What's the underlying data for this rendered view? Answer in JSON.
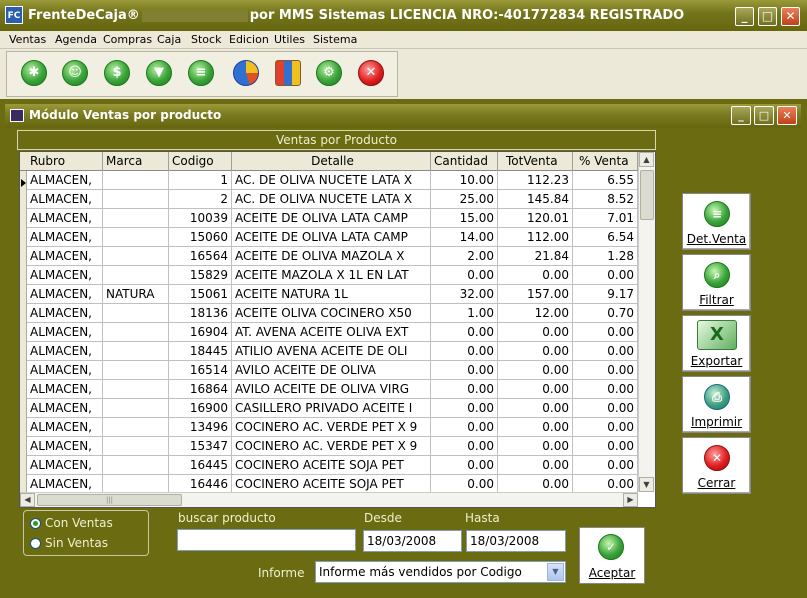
{
  "app": {
    "title_left": "FrenteDeCaja®",
    "title_right": "por MMS Sistemas       LICENCIA NRO:-401772834 REGISTRADO",
    "logo_text": "FC"
  },
  "window_buttons": {
    "minimize": "_",
    "maximize": "□",
    "close": "✕"
  },
  "menu": [
    "Ventas",
    "Agenda",
    "Compras",
    "Caja",
    "Stock",
    "Edicion",
    "Utiles",
    "Sistema"
  ],
  "toolbar": {
    "icons": [
      "ventas-icon",
      "agenda-icon",
      "caja-icon",
      "compras-icon",
      "stock-icon",
      "pie-chart-icon",
      "bar-chart-icon",
      "settings-icon",
      "exit-icon"
    ],
    "glyphs": [
      "✱",
      "☺",
      "$",
      "▼",
      "≡",
      "",
      "",
      "⚙",
      "✕"
    ]
  },
  "child_window": {
    "title": "Módulo Ventas por producto",
    "panel_title": "Ventas por Producto"
  },
  "grid": {
    "columns": [
      "Rubro",
      "Marca",
      "Codigo",
      "Detalle",
      "Cantidad",
      "TotVenta",
      "% Venta"
    ],
    "rows": [
      [
        "ALMACEN,",
        "",
        "1",
        "AC. DE OLIVA NUCETE LATA X",
        "10.00",
        "112.23",
        "6.55"
      ],
      [
        "ALMACEN,",
        "",
        "2",
        "AC. DE OLIVA NUCETE LATA X",
        "25.00",
        "145.84",
        "8.52"
      ],
      [
        "ALMACEN,",
        "",
        "10039",
        "ACEITE DE OLIVA LATA CAMP",
        "15.00",
        "120.01",
        "7.01"
      ],
      [
        "ALMACEN,",
        "",
        "15060",
        "ACEITE DE OLIVA LATA CAMP",
        "14.00",
        "112.00",
        "6.54"
      ],
      [
        "ALMACEN,",
        "",
        "16564",
        "ACEITE DE OLIVA MAZOLA X",
        "2.00",
        "21.84",
        "1.28"
      ],
      [
        "ALMACEN,",
        "",
        "15829",
        "ACEITE MAZOLA X 1L EN LAT",
        "0.00",
        "0.00",
        "0.00"
      ],
      [
        "ALMACEN,",
        "NATURA",
        "15061",
        "ACEITE NATURA 1L",
        "32.00",
        "157.00",
        "9.17"
      ],
      [
        "ALMACEN,",
        "",
        "18136",
        "ACEITE OLIVA COCINERO X50",
        "1.00",
        "12.00",
        "0.70"
      ],
      [
        "ALMACEN,",
        "",
        "16904",
        "AT. AVENA ACEITE OLIVA EXT",
        "0.00",
        "0.00",
        "0.00"
      ],
      [
        "ALMACEN,",
        "",
        "18445",
        "ATILIO AVENA ACEITE DE OLI",
        "0.00",
        "0.00",
        "0.00"
      ],
      [
        "ALMACEN,",
        "",
        "16514",
        "AVILO ACEITE DE OLIVA",
        "0.00",
        "0.00",
        "0.00"
      ],
      [
        "ALMACEN,",
        "",
        "16864",
        "AVILO ACEITE DE OLIVA VIRG",
        "0.00",
        "0.00",
        "0.00"
      ],
      [
        "ALMACEN,",
        "",
        "16900",
        "CASILLERO PRIVADO ACEITE I",
        "0.00",
        "0.00",
        "0.00"
      ],
      [
        "ALMACEN,",
        "",
        "13496",
        "COCINERO AC. VERDE PET X 9",
        "0.00",
        "0.00",
        "0.00"
      ],
      [
        "ALMACEN,",
        "",
        "15347",
        "COCINERO AC. VERDE PET X 9",
        "0.00",
        "0.00",
        "0.00"
      ],
      [
        "ALMACEN,",
        "",
        "16445",
        "COCINERO ACEITE SOJA PET",
        "0.00",
        "0.00",
        "0.00"
      ],
      [
        "ALMACEN,",
        "",
        "16446",
        "COCINERO ACEITE SOJA PET",
        "0.00",
        "0.00",
        "0.00"
      ]
    ]
  },
  "side_buttons": [
    {
      "label": "Det.Venta",
      "icon": "detail-icon",
      "glyph": "≡"
    },
    {
      "label": "Filtrar",
      "icon": "filter-icon",
      "glyph": "⌕"
    },
    {
      "label": "Exportar",
      "icon": "excel-icon",
      "glyph": "X"
    },
    {
      "label": "Imprimir",
      "icon": "printer-icon",
      "glyph": "⎙"
    },
    {
      "label": "Cerrar",
      "icon": "close-icon",
      "glyph": "✕"
    }
  ],
  "filters": {
    "radio_options": [
      {
        "label": "Con Ventas",
        "checked": true
      },
      {
        "label": "Sin Ventas",
        "checked": false
      }
    ],
    "search_label": "buscar producto",
    "search_value": "",
    "desde_label": "Desde",
    "desde_value": "18/03/2008",
    "hasta_label": "Hasta",
    "hasta_value": "18/03/2008",
    "informe_label": "Informe",
    "informe_value": "Informe más vendidos por Codigo"
  },
  "accept_button": {
    "label": "Aceptar",
    "glyph": "✓"
  }
}
